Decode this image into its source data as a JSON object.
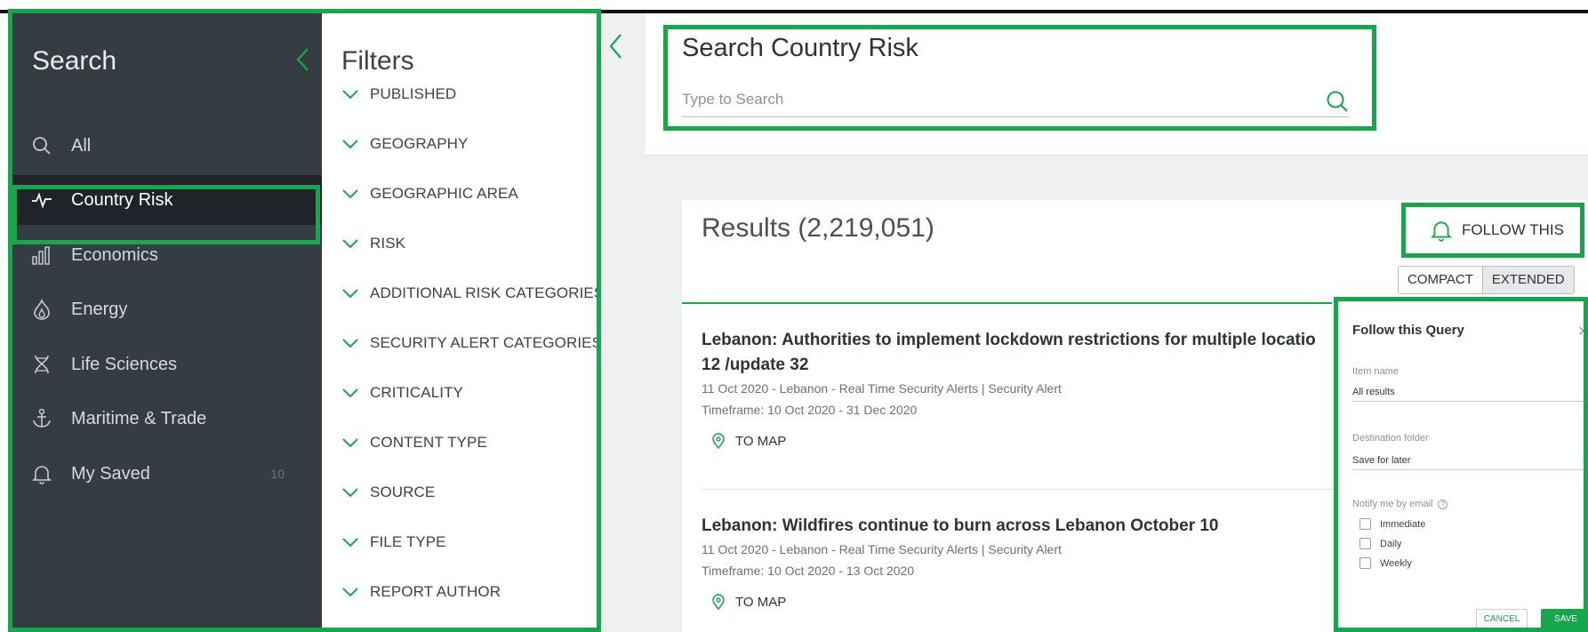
{
  "sidebar": {
    "title": "Search",
    "items": [
      {
        "label": "All",
        "icon": "search-icon",
        "active": false
      },
      {
        "label": "Country Risk",
        "icon": "pulse-icon",
        "active": true
      },
      {
        "label": "Economics",
        "icon": "bar-chart-icon",
        "active": false
      },
      {
        "label": "Energy",
        "icon": "flame-icon",
        "active": false
      },
      {
        "label": "Life Sciences",
        "icon": "dna-icon",
        "active": false
      },
      {
        "label": "Maritime & Trade",
        "icon": "anchor-icon",
        "active": false
      },
      {
        "label": "My Saved",
        "icon": "bell-icon",
        "active": false,
        "count": "10"
      }
    ]
  },
  "filters": {
    "title": "Filters",
    "items": [
      "PUBLISHED",
      "GEOGRAPHY",
      "GEOGRAPHIC AREA",
      "RISK",
      "ADDITIONAL RISK CATEGORIES",
      "SECURITY ALERT CATEGORIES",
      "CRITICALITY",
      "CONTENT TYPE",
      "SOURCE",
      "FILE TYPE",
      "REPORT AUTHOR"
    ]
  },
  "search": {
    "title": "Search Country Risk",
    "placeholder": "Type to Search"
  },
  "results": {
    "title": "Results (2,219,051)",
    "follow_label": "FOLLOW THIS",
    "view_compact": "COMPACT",
    "view_extended": "EXTENDED",
    "view_selected": "EXTENDED",
    "items": [
      {
        "title_line1": "Lebanon: Authorities to implement lockdown restrictions for multiple locatio",
        "title_line2": "12 /update 32",
        "meta": "11 Oct 2020 - Lebanon - Real Time Security Alerts | Security Alert",
        "timeframe": "Timeframe: 10 Oct 2020 - 31 Dec 2020",
        "map_label": "TO MAP"
      },
      {
        "title_line1": "Lebanon: Wildfires continue to burn across Lebanon October 10",
        "meta": "11 Oct 2020 - Lebanon - Real Time Security Alerts | Security Alert",
        "timeframe": "Timeframe: 10 Oct 2020 - 13 Oct 2020",
        "map_label": "TO MAP"
      }
    ]
  },
  "follow_popup": {
    "title": "Follow this Query",
    "item_name_label": "Item name",
    "item_name_value": "All results",
    "folder_label": "Destination folder",
    "folder_value": "Save for later",
    "notify_label": "Notify me by email",
    "options": [
      "Immediate",
      "Daily",
      "Weekly"
    ],
    "cancel_label": "CANCEL",
    "save_label": "SAVE"
  },
  "colors": {
    "accent": "#14a84a",
    "nav_bg": "#353c42",
    "nav_active_bg": "#202428",
    "main_bg": "#eef0f1"
  }
}
